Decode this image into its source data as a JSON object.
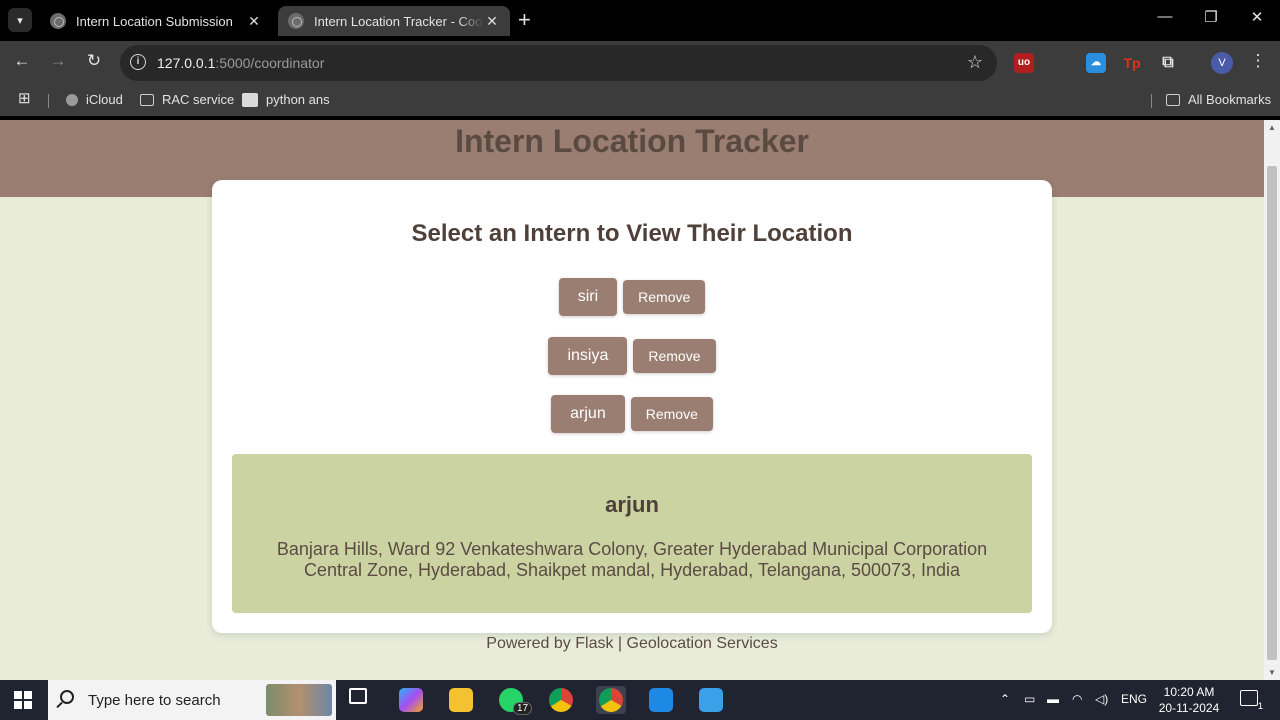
{
  "browser": {
    "tabs": [
      {
        "title": "Intern Location Submission"
      },
      {
        "title": "Intern Location Tracker - Coordinator"
      }
    ],
    "url_host": "127.0.0.1",
    "url_path": ":5000/coordinator",
    "bookmarks": [
      {
        "label": "iCloud"
      },
      {
        "label": "RAC service"
      },
      {
        "label": "python ans"
      }
    ],
    "all_bookmarks": "All Bookmarks",
    "profile_initial": "V"
  },
  "page": {
    "title": "Intern Location Tracker",
    "card_heading": "Select an Intern to View Their Location",
    "interns": [
      {
        "name": "siri",
        "remove_label": "Remove"
      },
      {
        "name": "insiya",
        "remove_label": "Remove"
      },
      {
        "name": "arjun",
        "remove_label": "Remove"
      }
    ],
    "selected": {
      "name": "arjun",
      "address": "Banjara Hills, Ward 92 Venkateshwara Colony, Greater Hyderabad Municipal Corporation Central Zone, Hyderabad, Shaikpet mandal, Hyderabad, Telangana, 500073, India"
    },
    "footer": "Powered by Flask | Geolocation Services"
  },
  "taskbar": {
    "search_placeholder": "Type here to search",
    "whatsapp_badge": "17",
    "language": "ENG",
    "time": "10:20 AM",
    "date": "20-11-2024",
    "notification_count": "1"
  },
  "colors": {
    "header_brown": "#9a7e72",
    "page_bg": "#e8ecd9",
    "location_box": "#cbd3a3",
    "title_text": "#5a4a42"
  }
}
